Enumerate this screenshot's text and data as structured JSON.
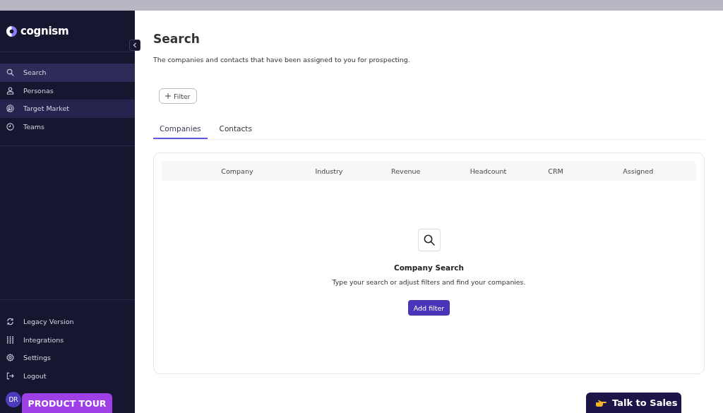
{
  "sidebar": {
    "logo": "cognism",
    "nav_items": [
      {
        "label": "Search",
        "kind": "search",
        "selected": true,
        "hovered": false
      },
      {
        "label": "Personas",
        "kind": "person",
        "selected": false,
        "hovered": false
      },
      {
        "label": "Target Market",
        "kind": "target",
        "selected": false,
        "hovered": true
      },
      {
        "label": "Teams",
        "kind": "clock",
        "selected": false,
        "hovered": false
      }
    ],
    "bottom_items": [
      {
        "label": "Legacy Version",
        "kind": "refresh"
      },
      {
        "label": "Integrations",
        "kind": "grid"
      },
      {
        "label": "Settings",
        "kind": "gear"
      },
      {
        "label": "Logout",
        "kind": "logout"
      }
    ],
    "avatar": "DR"
  },
  "page": {
    "title": "Search",
    "description": "The companies and contacts that have been assigned to you for prospecting.",
    "filter_button": "Filter",
    "tabs": [
      {
        "label": "Companies",
        "selected": true
      },
      {
        "label": "Contacts",
        "selected": false
      }
    ],
    "table": {
      "columns": [
        "Company",
        "Industry",
        "Revenue",
        "Headcount",
        "CRM",
        "Assigned"
      ]
    },
    "empty_state": {
      "title": "Company Search",
      "description": "Type your search or adjust filters and find your companies.",
      "button": "Add filter"
    }
  },
  "product_tour_button": "PRODUCT TOUR",
  "talk_to_sales_button": "Talk to Sales"
}
